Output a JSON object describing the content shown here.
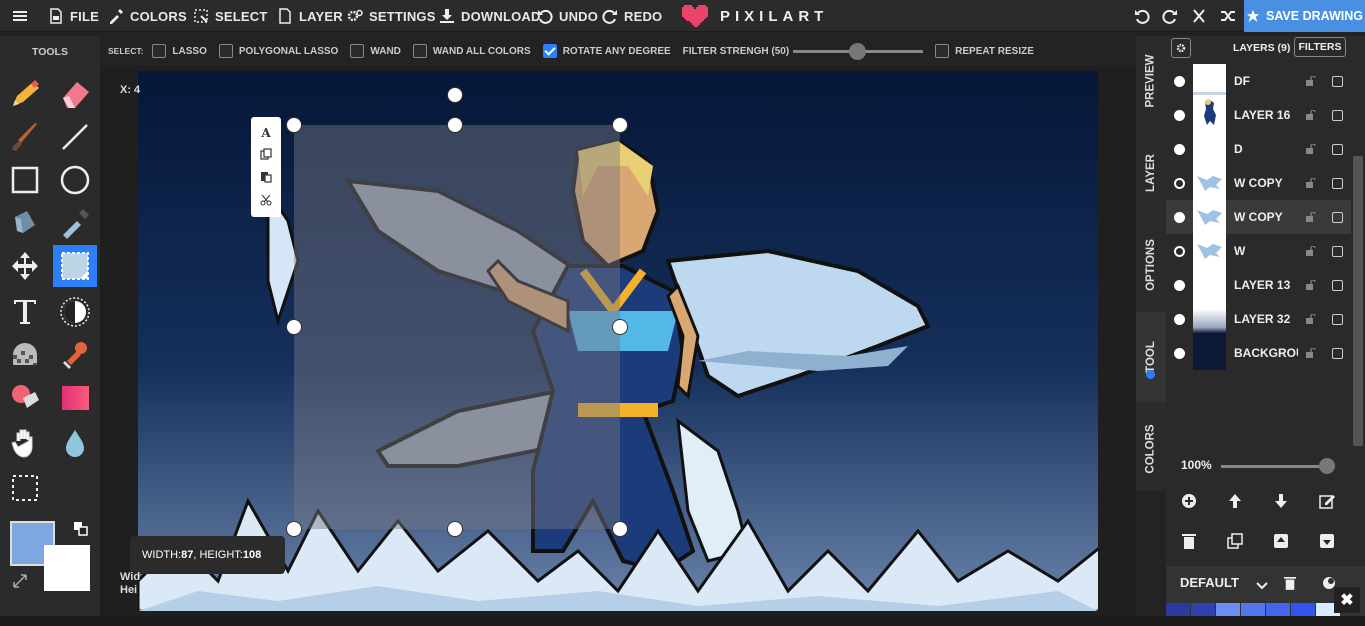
{
  "menu": {
    "file": "FILE",
    "colors": "COLORS",
    "select": "SELECT",
    "layer": "LAYER",
    "settings": "SETTINGS",
    "download": "DOWNLOAD",
    "undo": "UNDO",
    "redo": "REDO"
  },
  "logo": {
    "text": "PIXILART",
    "color": "#e8456b"
  },
  "save": {
    "label": "SAVE DRAWING",
    "color": "#4a90e2"
  },
  "tools": {
    "title": "TOOLS"
  },
  "select_options": {
    "label": "SELECT:",
    "items": [
      {
        "label": "LASSO",
        "checked": false
      },
      {
        "label": "POLYGONAL LASSO",
        "checked": false
      },
      {
        "label": "WAND",
        "checked": false
      },
      {
        "label": "WAND ALL COLORS",
        "checked": false
      },
      {
        "label": "ROTATE ANY DEGREE",
        "checked": true
      }
    ],
    "filter_label": "FILTER STRENGH (50)",
    "filter_value": 50,
    "repeat_label": "REPEAT RESIZE"
  },
  "canvas": {
    "coord_text": "X: 4",
    "wh_line1": "Wid",
    "wh_line2": "Hei"
  },
  "dim_tip": {
    "prefix_w": "WIDTH: ",
    "width": "87",
    "prefix_h": ", HEIGHT: ",
    "height": "108"
  },
  "side_tabs": [
    "PREVIEW",
    "LAYER",
    "OPTIONS",
    "TOOL",
    "COLORS"
  ],
  "layers": {
    "header": "LAYERS (9)",
    "filters": "FILTERS",
    "items": [
      {
        "name": "DF",
        "visible": true
      },
      {
        "name": "LAYER 16",
        "visible": true
      },
      {
        "name": "D",
        "visible": true
      },
      {
        "name": "W COPY",
        "visible": false
      },
      {
        "name": "W COPY",
        "visible": true,
        "selected": true
      },
      {
        "name": "W",
        "visible": false
      },
      {
        "name": "LAYER 13",
        "visible": true
      },
      {
        "name": "LAYER 32",
        "visible": true
      },
      {
        "name": "BACKGROUND",
        "visible": true
      }
    ]
  },
  "zoom": {
    "label": "100%",
    "value": 100
  },
  "palette": {
    "name": "DEFAULT",
    "swatches": [
      "#2a3aa0",
      "#3040b0",
      "#6a8ff0",
      "#5577ee",
      "#4466ee",
      "#3355ee",
      "#d8ecff"
    ]
  },
  "colors": {
    "primary": "#7ea7e0",
    "secondary": "#ffffff",
    "accent": "#2d7ff9"
  }
}
